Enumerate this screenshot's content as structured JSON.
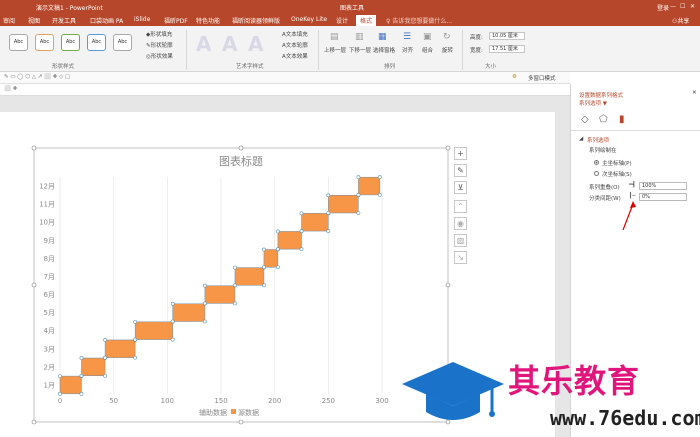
{
  "window": {
    "doc_title": "演示文稿1 - PowerPoint",
    "tool_context": "图表工具",
    "user": "登录",
    "share": "共享",
    "win_controls": [
      "—",
      "☐",
      "✕"
    ]
  },
  "tabs": [
    {
      "label": "审阅"
    },
    {
      "label": "视图"
    },
    {
      "label": "开发工具"
    },
    {
      "label": "口袋动画 PA"
    },
    {
      "label": "iSlide"
    },
    {
      "label": "福昕PDF"
    },
    {
      "label": "特色功能"
    },
    {
      "label": "福昕阅读器领鲜版"
    },
    {
      "label": "OneKey Lite"
    },
    {
      "label": "设计"
    },
    {
      "label": "格式"
    }
  ],
  "search": {
    "placeholder": "告诉我您想要做什么..."
  },
  "ribbon": {
    "shape_styles": [
      "Abc",
      "Abc",
      "Abc",
      "Abc",
      "Abc"
    ],
    "fill": "形状填充",
    "outline": "形状轮廓",
    "effect": "形状效果",
    "group_shape_styles": "形状样式",
    "wordart": [
      "A",
      "A",
      "A"
    ],
    "text_fill": "文本填充",
    "text_outline": "文本轮廓",
    "text_effect": "文本效果",
    "group_wordart": "艺术字样式",
    "bring_forward": "上移一层",
    "send_backward": "下移一层",
    "selection_pane": "选择窗格",
    "align": "对齐",
    "group": "组合",
    "rotate": "旋转",
    "group_arrange": "排列",
    "height_label": "高度:",
    "height_value": "10.05 厘米",
    "width_label": "宽度:",
    "width_value": "17.51 厘米",
    "group_size": "大小"
  },
  "toolbar2": {
    "multi_window": "多窗口模式"
  },
  "chart_data": {
    "type": "bar",
    "title": "图表标题",
    "categories": [
      "1月",
      "2月",
      "3月",
      "4月",
      "5月",
      "6月",
      "7月",
      "8月",
      "9月",
      "10月",
      "11月",
      "12月"
    ],
    "xlim": [
      0,
      300
    ],
    "xticks": [
      "0",
      "50",
      "100",
      "150",
      "200",
      "250",
      "300"
    ],
    "series": [
      {
        "name": "辅助数据",
        "values": [
          0,
          20,
          42,
          70,
          105,
          135,
          163,
          190,
          203,
          225,
          250,
          278
        ],
        "color": "none"
      },
      {
        "name": "源数据",
        "values": [
          20,
          22,
          28,
          35,
          30,
          28,
          27,
          13,
          22,
          25,
          28,
          20
        ],
        "color": "#f79646"
      }
    ],
    "legend_position": "bottom",
    "grid": true
  },
  "chart_tools": [
    "+",
    "✎",
    "⊻"
  ],
  "pane": {
    "title": "设置数据系列格式",
    "subtitle": "系列选项 ▼",
    "section": "系列选项",
    "plot_on": "系列绘制在",
    "primary_axis": "主坐标轴(P)",
    "secondary_axis": "次坐标轴(S)",
    "overlap_label": "系列重叠(O)",
    "overlap_value": "100%",
    "gap_label": "分类间距(W)",
    "gap_value": "0%"
  },
  "watermark": {
    "name": "其乐教育",
    "url": "www.76edu.com"
  },
  "colors": {
    "accent": "#b7472a",
    "bar": "#f79646",
    "watermark_blue": "#1a73c9",
    "watermark_pink": "#e0167c"
  }
}
